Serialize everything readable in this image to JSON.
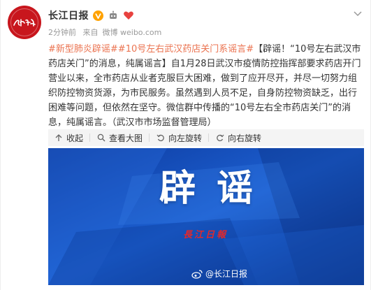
{
  "post": {
    "author": "长江日报",
    "time": "2分钟前",
    "source_prefix": "来自",
    "source": "微博 weibo.com",
    "avatar_text": "長江日報",
    "hashtag1": "#新型肺炎辟谣#",
    "hashtag2": "#10号左右武汉药店关门系谣言#",
    "body": "【辟谣！“10号左右武汉市药店关门”的消息，纯属谣言】自1月28日武汉市疫情防控指挥部要求药店开门营业以来，全市药店从业者克服巨大困难，做到了应开尽开，并尽一切努力组织防控物资货源，为市民服务。虽然遇到人员不足，自身防控物资缺乏，出行困难等问题，但依然在坚守。微信群中传播的“10号左右全市药店关门”的消息，纯属谣言。（武汉市市场监督管理局）"
  },
  "actions": {
    "collapse": "收起",
    "view_large": "查看大图",
    "rotate_left": "向左旋转",
    "rotate_right": "向右旋转"
  },
  "image": {
    "headline": "辟谣",
    "stamp": "長江日報",
    "watermark": "@长江日报"
  },
  "colors": {
    "link": "#eb7350",
    "image_bg": "#1450b8",
    "brand_red": "#c8161d",
    "verified": "#ffa200"
  }
}
